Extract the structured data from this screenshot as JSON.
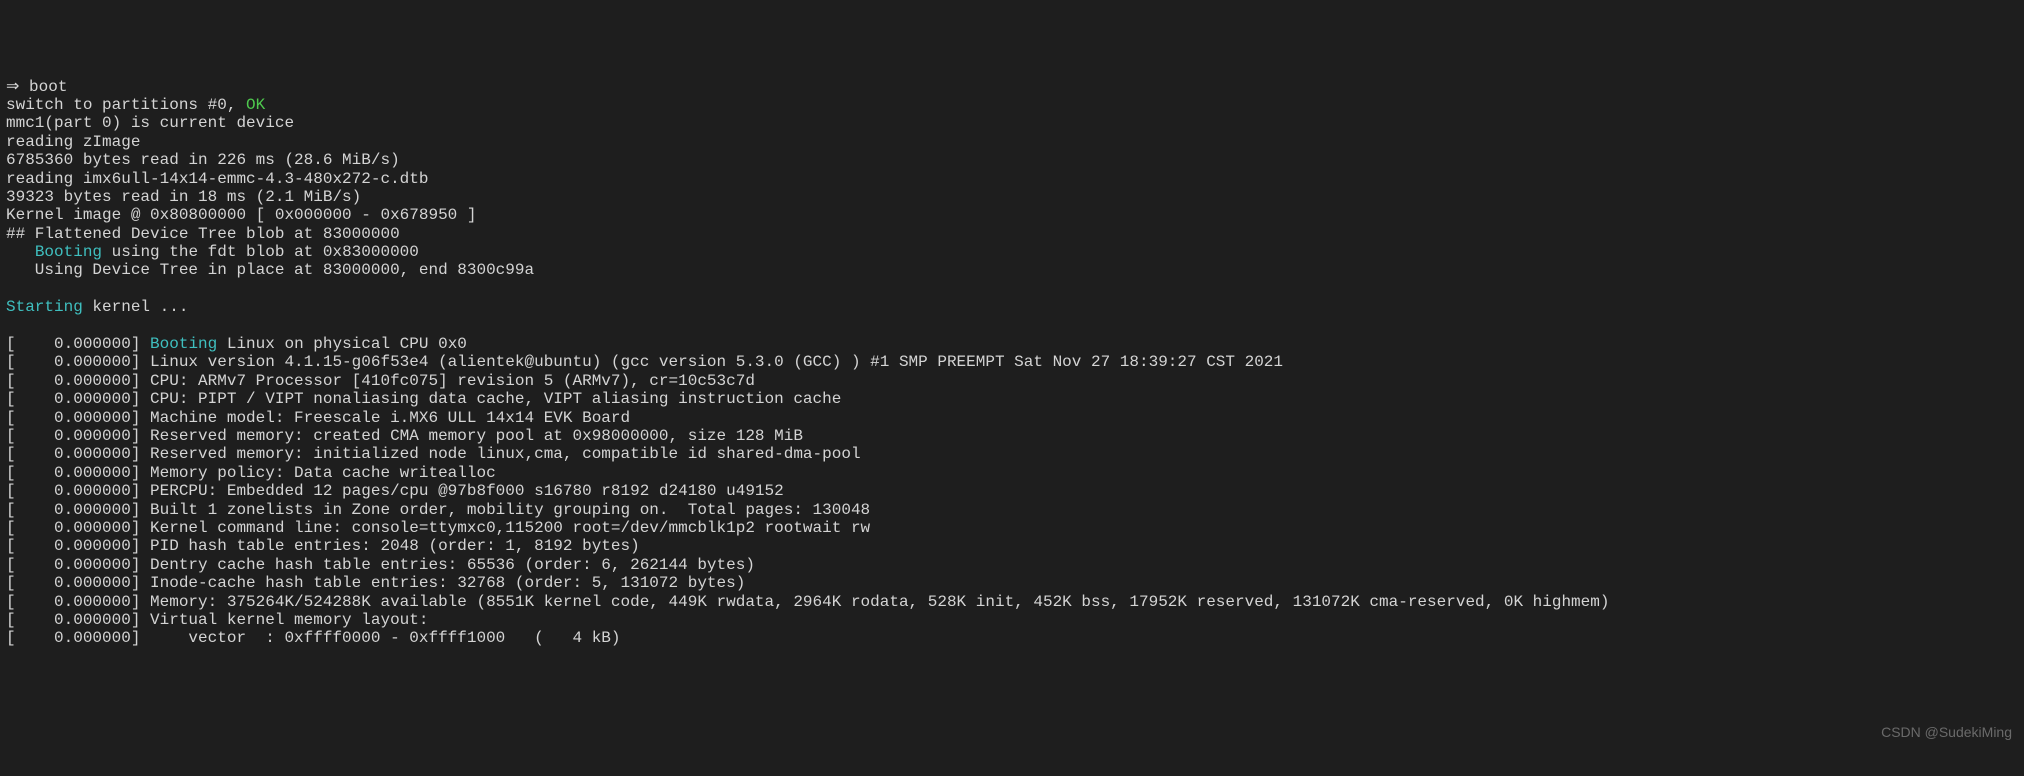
{
  "terminal": {
    "lines": [
      {
        "segments": [
          {
            "text": "⇒ boot",
            "class": ""
          }
        ]
      },
      {
        "segments": [
          {
            "text": "switch to partitions #0, ",
            "class": ""
          },
          {
            "text": "OK",
            "class": "green"
          }
        ]
      },
      {
        "segments": [
          {
            "text": "mmc1(part 0) is current device",
            "class": ""
          }
        ]
      },
      {
        "segments": [
          {
            "text": "reading zImage",
            "class": ""
          }
        ]
      },
      {
        "segments": [
          {
            "text": "6785360 bytes read in 226 ms (28.6 MiB/s)",
            "class": ""
          }
        ]
      },
      {
        "segments": [
          {
            "text": "reading imx6ull-14x14-emmc-4.3-480x272-c.dtb",
            "class": ""
          }
        ]
      },
      {
        "segments": [
          {
            "text": "39323 bytes read in 18 ms (2.1 MiB/s)",
            "class": ""
          }
        ]
      },
      {
        "segments": [
          {
            "text": "Kernel image @ 0x80800000 [ 0x000000 - 0x678950 ]",
            "class": ""
          }
        ]
      },
      {
        "segments": [
          {
            "text": "## Flattened Device Tree blob at 83000000",
            "class": ""
          }
        ]
      },
      {
        "segments": [
          {
            "text": "   ",
            "class": ""
          },
          {
            "text": "Booting",
            "class": "cyan"
          },
          {
            "text": " using the fdt blob at 0x83000000",
            "class": ""
          }
        ]
      },
      {
        "segments": [
          {
            "text": "   Using Device Tree in place at 83000000, end 8300c99a",
            "class": ""
          }
        ]
      },
      {
        "segments": [
          {
            "text": "",
            "class": ""
          }
        ]
      },
      {
        "segments": [
          {
            "text": "Starting",
            "class": "cyan"
          },
          {
            "text": " kernel ...",
            "class": ""
          }
        ]
      },
      {
        "segments": [
          {
            "text": "",
            "class": ""
          }
        ]
      },
      {
        "segments": [
          {
            "text": "[    0.000000] ",
            "class": ""
          },
          {
            "text": "Booting",
            "class": "cyan"
          },
          {
            "text": " Linux on physical CPU 0x0",
            "class": ""
          }
        ]
      },
      {
        "segments": [
          {
            "text": "[    0.000000] Linux version 4.1.15-g06f53e4 (alientek@ubuntu) (gcc version 5.3.0 (GCC) ) #1 SMP PREEMPT Sat Nov 27 18:39:27 CST 2021",
            "class": ""
          }
        ]
      },
      {
        "segments": [
          {
            "text": "[    0.000000] CPU: ARMv7 Processor [410fc075] revision 5 (ARMv7), cr=10c53c7d",
            "class": ""
          }
        ]
      },
      {
        "segments": [
          {
            "text": "[    0.000000] CPU: PIPT / VIPT nonaliasing data cache, VIPT aliasing instruction cache",
            "class": ""
          }
        ]
      },
      {
        "segments": [
          {
            "text": "[    0.000000] Machine model: Freescale i.MX6 ULL 14x14 EVK Board",
            "class": ""
          }
        ]
      },
      {
        "segments": [
          {
            "text": "[    0.000000] Reserved memory: created CMA memory pool at 0x98000000, size 128 MiB",
            "class": ""
          }
        ]
      },
      {
        "segments": [
          {
            "text": "[    0.000000] Reserved memory: initialized node linux,cma, compatible id shared-dma-pool",
            "class": ""
          }
        ]
      },
      {
        "segments": [
          {
            "text": "[    0.000000] Memory policy: Data cache writealloc",
            "class": ""
          }
        ]
      },
      {
        "segments": [
          {
            "text": "[    0.000000] PERCPU: Embedded 12 pages/cpu @97b8f000 s16780 r8192 d24180 u49152",
            "class": ""
          }
        ]
      },
      {
        "segments": [
          {
            "text": "[    0.000000] Built 1 zonelists in Zone order, mobility grouping on.  Total pages: 130048",
            "class": ""
          }
        ]
      },
      {
        "segments": [
          {
            "text": "[    0.000000] Kernel command line: console=ttymxc0,115200 root=/dev/mmcblk1p2 rootwait rw",
            "class": ""
          }
        ]
      },
      {
        "segments": [
          {
            "text": "[    0.000000] PID hash table entries: 2048 (order: 1, 8192 bytes)",
            "class": ""
          }
        ]
      },
      {
        "segments": [
          {
            "text": "[    0.000000] Dentry cache hash table entries: 65536 (order: 6, 262144 bytes)",
            "class": ""
          }
        ]
      },
      {
        "segments": [
          {
            "text": "[    0.000000] Inode-cache hash table entries: 32768 (order: 5, 131072 bytes)",
            "class": ""
          }
        ]
      },
      {
        "segments": [
          {
            "text": "[    0.000000] Memory: 375264K/524288K available (8551K kernel code, 449K rwdata, 2964K rodata, 528K init, 452K bss, 17952K reserved, 131072K cma-reserved, 0K highmem)",
            "class": ""
          }
        ]
      },
      {
        "segments": [
          {
            "text": "[    0.000000] Virtual kernel memory layout:",
            "class": ""
          }
        ]
      },
      {
        "segments": [
          {
            "text": "[    0.000000]     vector  : 0xffff0000 - 0xffff1000   (   4 kB)",
            "class": ""
          }
        ]
      }
    ]
  },
  "watermark": "CSDN @SudekiMing"
}
